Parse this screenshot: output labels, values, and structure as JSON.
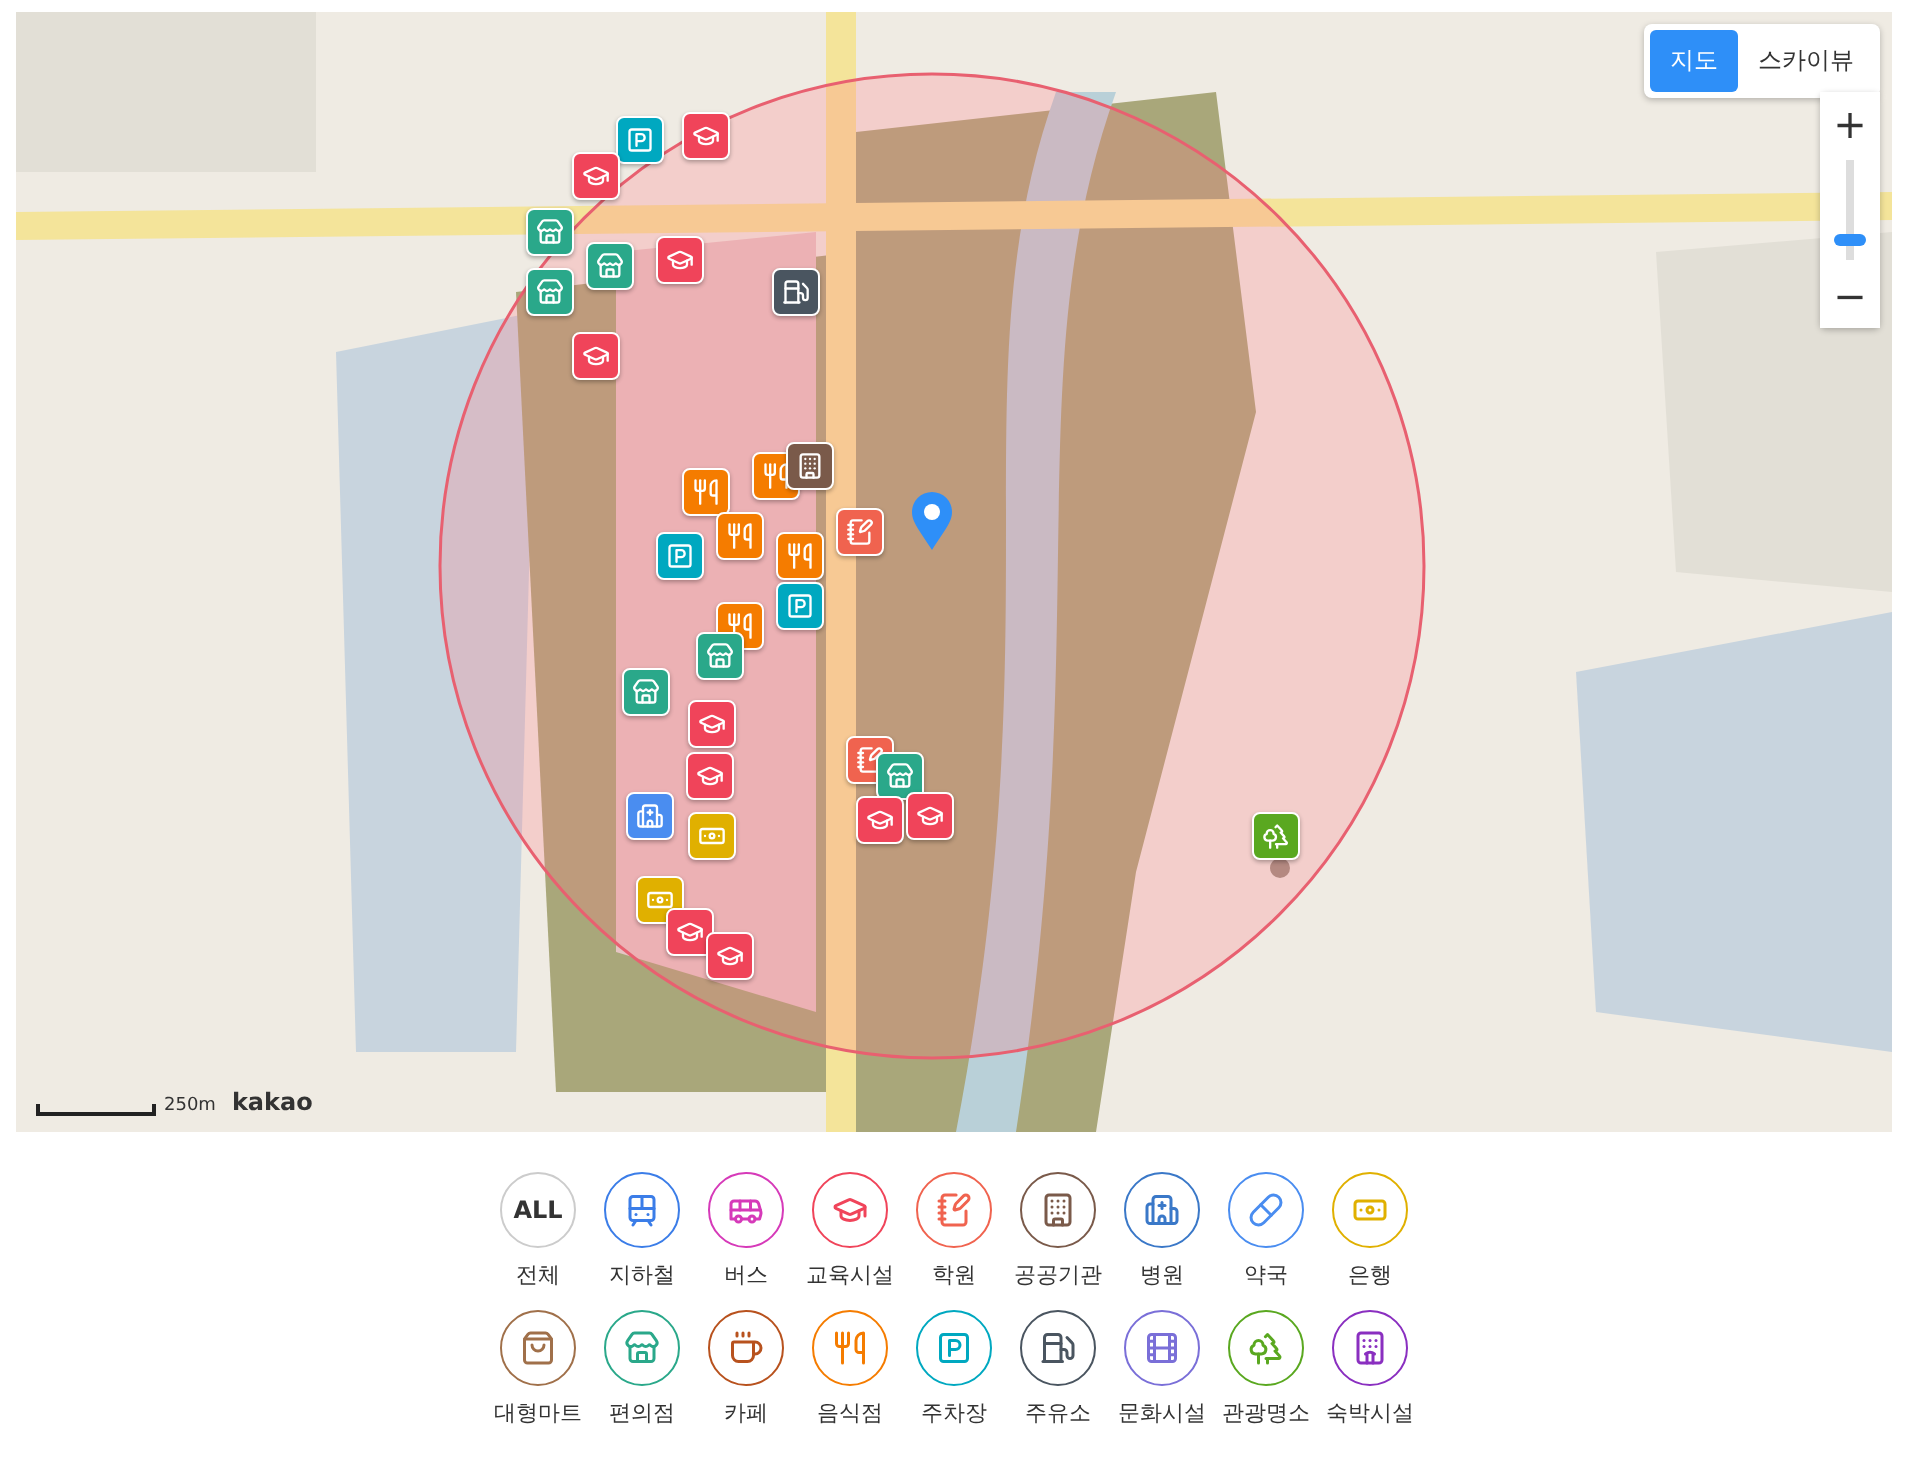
{
  "map": {
    "map_types": [
      {
        "label": "지도",
        "selected": true
      },
      {
        "label": "스카이뷰",
        "selected": false
      }
    ],
    "zoom": {
      "in": "+",
      "out": "−",
      "level": 0.2
    },
    "scale": "250m",
    "logo": "kakao"
  },
  "categories": [
    {
      "kind": "all",
      "text": "ALL",
      "label": "전체",
      "color": "#cccccc"
    },
    {
      "kind": "subway",
      "label": "지하철",
      "color": "#3b7de8"
    },
    {
      "kind": "bus",
      "label": "버스",
      "color": "#d63ab9"
    },
    {
      "kind": "education",
      "label": "교육시설",
      "color": "#f0445a"
    },
    {
      "kind": "academy",
      "label": "학원",
      "color": "#f0634f"
    },
    {
      "kind": "public",
      "label": "공공기관",
      "color": "#7a5a4a"
    },
    {
      "kind": "hospital",
      "label": "병원",
      "color": "#3a78c8"
    },
    {
      "kind": "pharmacy",
      "label": "약국",
      "color": "#4a8df0"
    },
    {
      "kind": "bank",
      "label": "은행",
      "color": "#e0b000"
    },
    {
      "kind": "mart",
      "label": "대형마트",
      "color": "#a0704a"
    },
    {
      "kind": "convenience",
      "label": "편의점",
      "color": "#2aa88a"
    },
    {
      "kind": "cafe",
      "label": "카페",
      "color": "#b8521e"
    },
    {
      "kind": "restaurant",
      "label": "음식점",
      "color": "#f57c00"
    },
    {
      "kind": "parking",
      "label": "주차장",
      "color": "#00a8c0"
    },
    {
      "kind": "gas",
      "label": "주유소",
      "color": "#4a5560"
    },
    {
      "kind": "culture",
      "label": "문화시설",
      "color": "#7a6fd8"
    },
    {
      "kind": "tourist",
      "label": "관광명소",
      "color": "#5aa820"
    },
    {
      "kind": "lodging",
      "label": "숙박시설",
      "color": "#8a2fc0"
    }
  ]
}
